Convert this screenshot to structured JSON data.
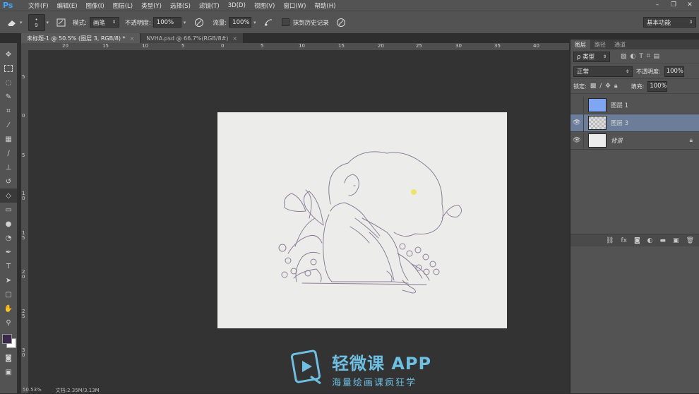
{
  "app": {
    "logo": "Ps"
  },
  "menu": [
    "文件(F)",
    "编辑(E)",
    "图像(I)",
    "图层(L)",
    "类型(Y)",
    "选择(S)",
    "滤镜(T)",
    "3D(D)",
    "视图(V)",
    "窗口(W)",
    "帮助(H)"
  ],
  "window_controls": {
    "minimize": "–",
    "restore": "❐",
    "close": "✕"
  },
  "options": {
    "brush_size": "9",
    "mode_label": "模式:",
    "mode_value": "画笔",
    "opacity_label": "不透明度:",
    "opacity_value": "100%",
    "flow_label": "流量:",
    "flow_value": "100%",
    "history_label": "抹到历史记录",
    "workspace": "基本功能"
  },
  "tabs": [
    {
      "label": "未标题-1 @ 50.5% (图层 3, RGB/8) *",
      "close": "×"
    },
    {
      "label": "NVHA.psd @ 66.7%(RGB/8#)",
      "close": "×"
    }
  ],
  "ruler": {
    "h_labels": [
      "20",
      "15",
      "10",
      "5",
      "0",
      "5",
      "10",
      "15",
      "20",
      "25",
      "30",
      "35",
      "40"
    ],
    "v_labels": [
      "5",
      "0",
      "5",
      "1 0",
      "1 5",
      "2 0",
      "2 5",
      "3 0"
    ]
  },
  "layers_panel": {
    "tabs": [
      "图层",
      "路径",
      "通道"
    ],
    "filter_label": "ρ 类型",
    "blend_mode": "正常",
    "opacity_label": "不透明度:",
    "opacity_value": "100%",
    "lock_label": "锁定:",
    "fill_label": "填充:",
    "fill_value": "100%",
    "layers": [
      {
        "name": "图层 1",
        "thumb_color": "#7ea6f3",
        "visible": false,
        "selected": false
      },
      {
        "name": "图层 3",
        "thumb_color": "#d0d0d0",
        "visible": true,
        "selected": true
      },
      {
        "name": "背景",
        "thumb_color": "#ececec",
        "visible": true,
        "selected": false
      }
    ],
    "footer_icons": [
      "link-icon",
      "fx-icon",
      "mask-icon",
      "adjustment-icon",
      "folder-icon",
      "new-layer-icon",
      "trash-icon"
    ]
  },
  "status": {
    "zoom": "50.53%",
    "doc": "文档:2.35M/3.13M"
  },
  "watermark": {
    "title": "轻微课 APP",
    "subtitle": "海量绘画课疯狂学",
    "color": "#6fbfe2"
  },
  "colors": {
    "accent": "#3fa6ff",
    "selected_layer": "#6b7d99",
    "foreground": "#3a2a4a",
    "background": "#ffffff"
  }
}
